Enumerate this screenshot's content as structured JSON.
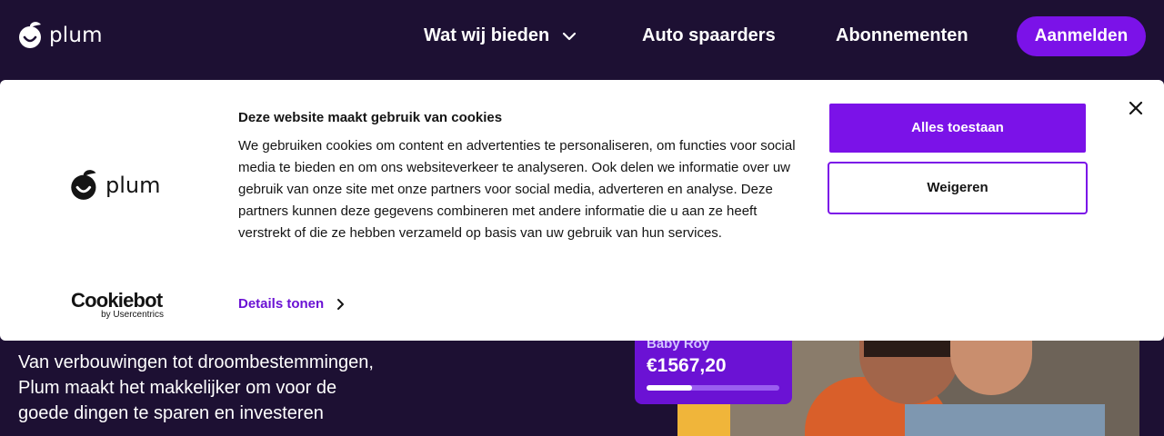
{
  "colors": {
    "background": "#1d1033",
    "accent": "#7b12e8",
    "dialog": "#ffffff",
    "link": "#6b12d4"
  },
  "nav": {
    "brand": "plum",
    "items": [
      {
        "label": "Wat wij bieden",
        "icon": "chevron-down-icon"
      },
      {
        "label": "Auto spaarders"
      },
      {
        "label": "Abonnementen"
      }
    ],
    "cta": "Aanmelden"
  },
  "hero": {
    "text": "Van verbouwingen tot droombestemmingen, Plum maakt het makkelijker om voor de goede dingen te sparen en investeren",
    "card": {
      "name": "Baby Roy",
      "amount": "€1567,20",
      "progress": 0.34
    }
  },
  "cookie_dialog": {
    "brand": "plum",
    "title": "Deze website maakt gebruik van cookies",
    "body": "We gebruiken cookies om content en advertenties te personaliseren, om functies voor social media te bieden en om ons websiteverkeer te analyseren. Ook delen we informatie over uw gebruik van onze site met onze partners voor social media, adverteren en analyse. Deze partners kunnen deze gegevens combineren met andere informatie die u aan ze heeft verstrekt of die ze hebben verzameld op basis van uw gebruik van hun services.",
    "details_link": "Details tonen",
    "allow_button": "Alles toestaan",
    "deny_button": "Weigeren",
    "provider": {
      "name": "Cookiebot",
      "byline": "by Usercentrics"
    },
    "close_icon": "close-icon"
  }
}
